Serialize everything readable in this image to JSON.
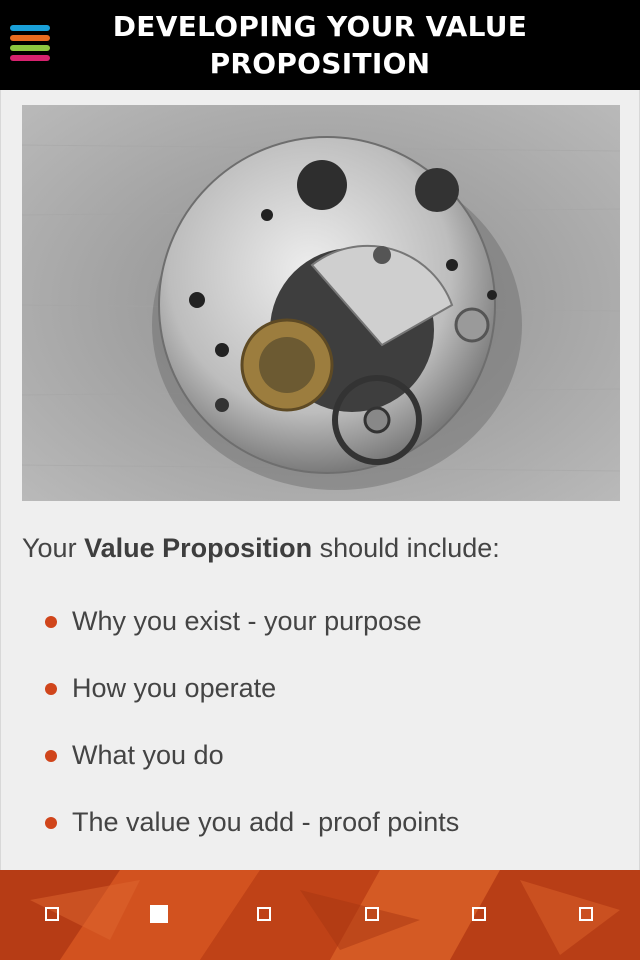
{
  "header": {
    "title": "DEVELOPING YOUR VALUE PROPOSITION",
    "menu_icon": "hamburger-menu-icon",
    "menu_colors": [
      "#1aa0d8",
      "#e86b1f",
      "#8dc63f",
      "#d6226e"
    ]
  },
  "hero": {
    "image": "watch-movement-photo"
  },
  "intro": {
    "prefix": "Your ",
    "emphasis": "Value Proposition",
    "suffix": " should include:"
  },
  "bullets": [
    "Why you exist - your purpose",
    "How you operate",
    "What you do",
    "The value you add - proof points"
  ],
  "colors": {
    "bullet": "#d0451b",
    "footer": "#c8461a"
  },
  "pager": {
    "count": 6,
    "active_index": 1
  }
}
